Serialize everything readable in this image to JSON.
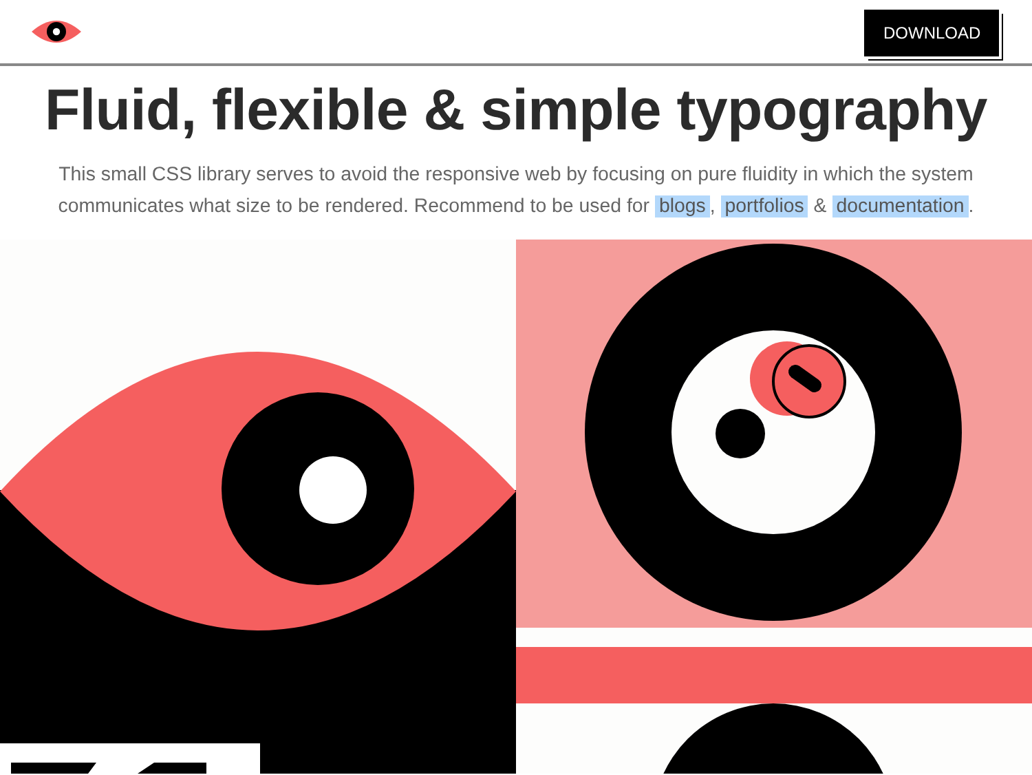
{
  "header": {
    "download_button": "DOWNLOAD"
  },
  "title": "Fluid, flexible & simple typography",
  "intro": [
    {
      "kind": "text",
      "text": "This small CSS library serves to avoid the responsive web by focusing on pure fluidity in which the system communicates what size to be rendered. Recommend to be used for "
    },
    {
      "kind": "link",
      "text": "blogs"
    },
    {
      "kind": "text",
      "text": ", "
    },
    {
      "kind": "link",
      "text": "portfolios"
    },
    {
      "kind": "text",
      "text": " & "
    },
    {
      "kind": "link",
      "text": "documentation"
    },
    {
      "kind": "text",
      "text": "."
    }
  ]
}
